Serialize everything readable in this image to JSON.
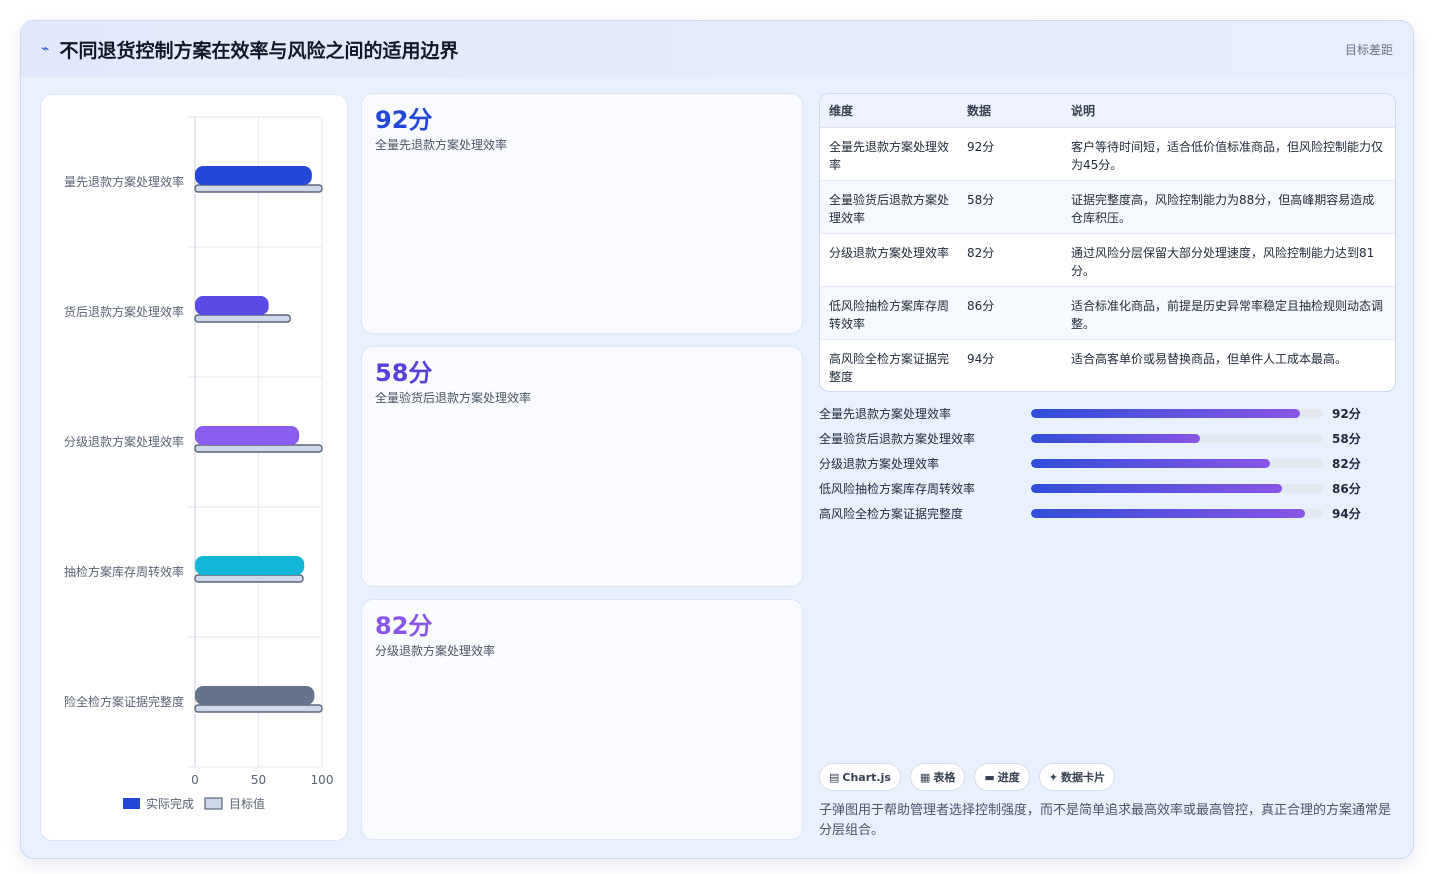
{
  "header": {
    "logo": "⌁",
    "title": "不同退货控制方案在效率与风险之间的适用边界",
    "right_text": "目标差距"
  },
  "chart_data": {
    "type": "bar",
    "orientation": "horizontal",
    "categories": [
      "量先退款方案处理效率",
      "货后退款方案处理效率",
      "分级退款方案处理效率",
      "抽检方案库存周转效率",
      "险全检方案证据完整度"
    ],
    "series": [
      {
        "name": "实际完成",
        "values": [
          92,
          58,
          82,
          86,
          94
        ],
        "colors": [
          "#2347d6",
          "#5b4be6",
          "#8a5cf0",
          "#12b6d6",
          "#64748b"
        ]
      },
      {
        "name": "目标值",
        "values": [
          100,
          75,
          100,
          85,
          100
        ],
        "color": "#cdd8ea"
      }
    ],
    "xlim": [
      0,
      100
    ],
    "xticks": [
      "0",
      "50",
      "100"
    ],
    "legend_position": "bottom",
    "grid": true
  },
  "cards": [
    {
      "value": "92分",
      "label": "全量先退款方案处理效率",
      "color": "#2347d6"
    },
    {
      "value": "58分",
      "label": "全量验货后退款方案处理效率",
      "color": "#5b3fd6"
    },
    {
      "value": "82分",
      "label": "分级退款方案处理效率",
      "color": "#8a55e6"
    }
  ],
  "table": {
    "headers": [
      "维度",
      "数据",
      "说明"
    ],
    "rows": [
      [
        "全量先退款方案处理效率",
        "92分",
        "客户等待时间短，适合低价值标准商品，但风险控制能力仅为45分。"
      ],
      [
        "全量验货后退款方案处理效率",
        "58分",
        "证据完整度高，风险控制能力为88分，但高峰期容易造成仓库积压。"
      ],
      [
        "分级退款方案处理效率",
        "82分",
        "通过风险分层保留大部分处理速度，风险控制能力达到81分。"
      ],
      [
        "低风险抽检方案库存周转效率",
        "86分",
        "适合标准化商品，前提是历史异常率稳定且抽检规则动态调整。"
      ],
      [
        "高风险全检方案证据完整度",
        "94分",
        "适合高客单价或易替换商品，但单件人工成本最高。"
      ]
    ]
  },
  "progress": [
    {
      "label": "全量先退款方案处理效率",
      "value": 92,
      "text": "92分"
    },
    {
      "label": "全量验货后退款方案处理效率",
      "value": 58,
      "text": "58分"
    },
    {
      "label": "分级退款方案处理效率",
      "value": 82,
      "text": "82分"
    },
    {
      "label": "低风险抽检方案库存周转效率",
      "value": 86,
      "text": "86分"
    },
    {
      "label": "高风险全检方案证据完整度",
      "value": 94,
      "text": "94分"
    }
  ],
  "chips": [
    {
      "icon": "▤",
      "label": "Chart.js"
    },
    {
      "icon": "▦",
      "label": "表格"
    },
    {
      "icon": "▬",
      "label": "进度"
    },
    {
      "icon": "✦",
      "label": "数据卡片"
    }
  ],
  "note": "子弹图用于帮助管理者选择控制强度，而不是简单追求最高效率或最高管控，真正合理的方案通常是分层组合。"
}
